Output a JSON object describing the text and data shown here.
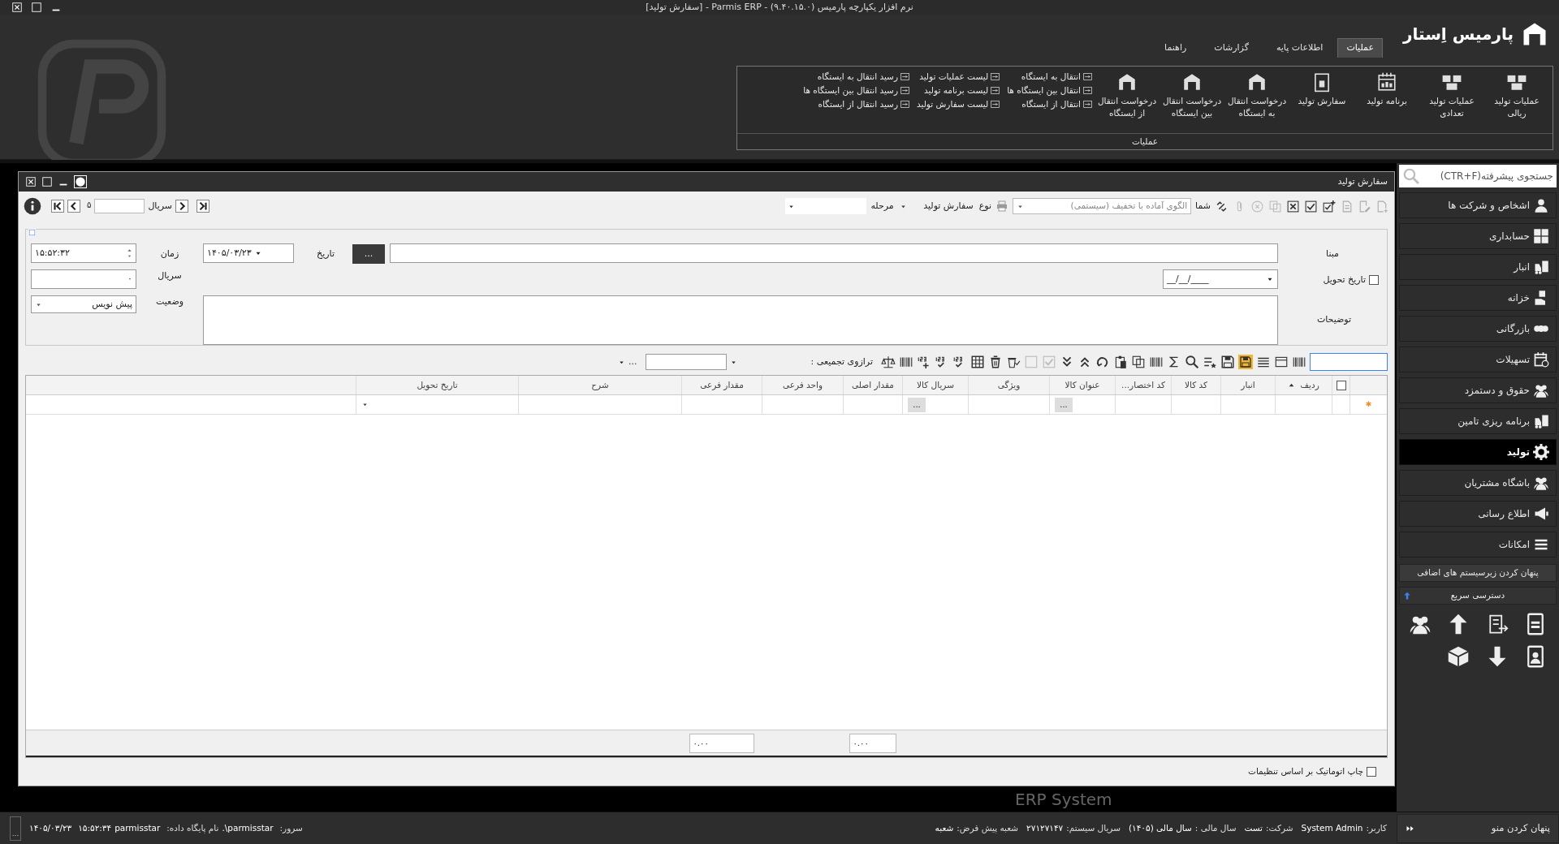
{
  "window": {
    "title": "نرم افزار یکپارچه پارمیس (۹.۴۰.۱۵.۰) - Parmis ERP - [سفارش تولید]"
  },
  "logo": {
    "text": "پارمیس اِستار"
  },
  "menu_tabs": [
    {
      "label": "عملیات",
      "selected": true
    },
    {
      "label": "اطلاعات پایه",
      "selected": false
    },
    {
      "label": "گزارشات",
      "selected": false
    },
    {
      "label": "راهنما",
      "selected": false
    }
  ],
  "ribbon": {
    "large_buttons": [
      "عملیات تولید ریالی",
      "عملیات تولید تعدادی",
      "برنامه تولید",
      "سفارش تولید",
      "درخواست انتقال به ایستگاه",
      "درخواست انتقال بین ایستگاه",
      "درخواست انتقال از ایستگاه"
    ],
    "small_columns": [
      [
        "انتقال به ایستگاه",
        "انتقال بین ایستگاه ها",
        "انتقال از ایستگاه"
      ],
      [
        "لیست عملیات تولید",
        "لیست برنامه تولید",
        "لیست سفارش تولید"
      ],
      [
        "رسید انتقال به ایستگاه",
        "رسید انتقال بین ایستگاه ها",
        "رسید انتقال از ایستگاه"
      ]
    ],
    "group_label": "عملیات"
  },
  "form": {
    "title": "سفارش تولید",
    "toolbar": {
      "template_label": "شما",
      "template": "الگوی آماده با تخفیف (سیستمی)",
      "type_label": "نوع",
      "type_value": "سفارش تولید",
      "stage_label": "مرحله",
      "serial_label": "سریال",
      "record_number": "۵"
    },
    "fields": {
      "basis_label": "مبنا",
      "basis_button": "...",
      "date_label": "تاریخ",
      "date_value": "۱۴۰۵/۰۳/۲۳",
      "time_label": "زمان",
      "time_value": "۱۵:۵۲:۳۲",
      "delivery_label": "تاریخ تحویل",
      "delivery_checked": false,
      "delivery_value": "__/__/____",
      "serial_label": "سریال",
      "serial_value": "۰",
      "status_label": "وضعیت",
      "status_value": "پیش نویس",
      "notes_label": "توضیحات"
    },
    "grid_toolbar": {
      "scale_label": "ترازوی تجمیعی :",
      "more": "..."
    },
    "grid": {
      "select_all_checked": false,
      "columns": [
        "ردیف",
        "انبار",
        "کد کالا",
        "کد اختصار...",
        "عنوان کالا",
        "ویژگی",
        "سریال کالا",
        "مقدار اصلی",
        "واحد فرعی",
        "مقدار فرعی",
        "شرح",
        "تاریخ تحویل"
      ],
      "new_row": {
        "marker": "✱",
        "title_button": "...",
        "serial_button": "..."
      },
      "totals": {
        "main_quantity": "۰.۰۰",
        "sub_quantity": "۰.۰۰"
      }
    },
    "auto_print": {
      "label": "چاپ اتوماتیک بر اساس تنظیمات",
      "checked": false
    }
  },
  "background_text": "ERP System",
  "sidebar": {
    "search_placeholder": "جستجوی پیشرفته(CTR+F)",
    "items": [
      {
        "label": "اشخاص و شرکت ها",
        "selected": false
      },
      {
        "label": "حسابداری",
        "selected": false
      },
      {
        "label": "انبار",
        "selected": false
      },
      {
        "label": "خزانه",
        "selected": false
      },
      {
        "label": "بازرگانی",
        "selected": false
      },
      {
        "label": "تسهیلات",
        "selected": false
      },
      {
        "label": "حقوق و دستمزد",
        "selected": false
      },
      {
        "label": "برنامه ریزی تامین",
        "selected": false
      },
      {
        "label": "تولید",
        "selected": true
      },
      {
        "label": "باشگاه مشتریان",
        "selected": false
      },
      {
        "label": "اطلاع رسانی",
        "selected": false
      },
      {
        "label": "امکانات",
        "selected": false
      }
    ],
    "hide_subsystems": "پنهان کردن زیرسیستم های اضافی",
    "quick_access": "دسترسی سریع",
    "hide_menu": "پنهان کردن منو"
  },
  "status_bar": {
    "right": [
      {
        "label": "کاربر:",
        "value": "System Admin"
      },
      {
        "label": "شرکت:",
        "value": "تست"
      },
      {
        "label": "سال مالی :",
        "value": "سال مالی (۱۴۰۵)"
      },
      {
        "label": "سریال سیستم:",
        "value": "۲۷۱۲۷۱۴۷"
      },
      {
        "label": "شعبه پیش فرض:",
        "value": "شعبه"
      }
    ],
    "left": [
      {
        "label": "سرور:",
        "value": ".\\parmisstar"
      },
      {
        "label": "نام پایگاه داده:",
        "value": "parmisstar"
      }
    ],
    "time": "۱۵:۵۲:۳۴",
    "date": "۱۴۰۵/۰۳/۲۳",
    "more": "..."
  }
}
